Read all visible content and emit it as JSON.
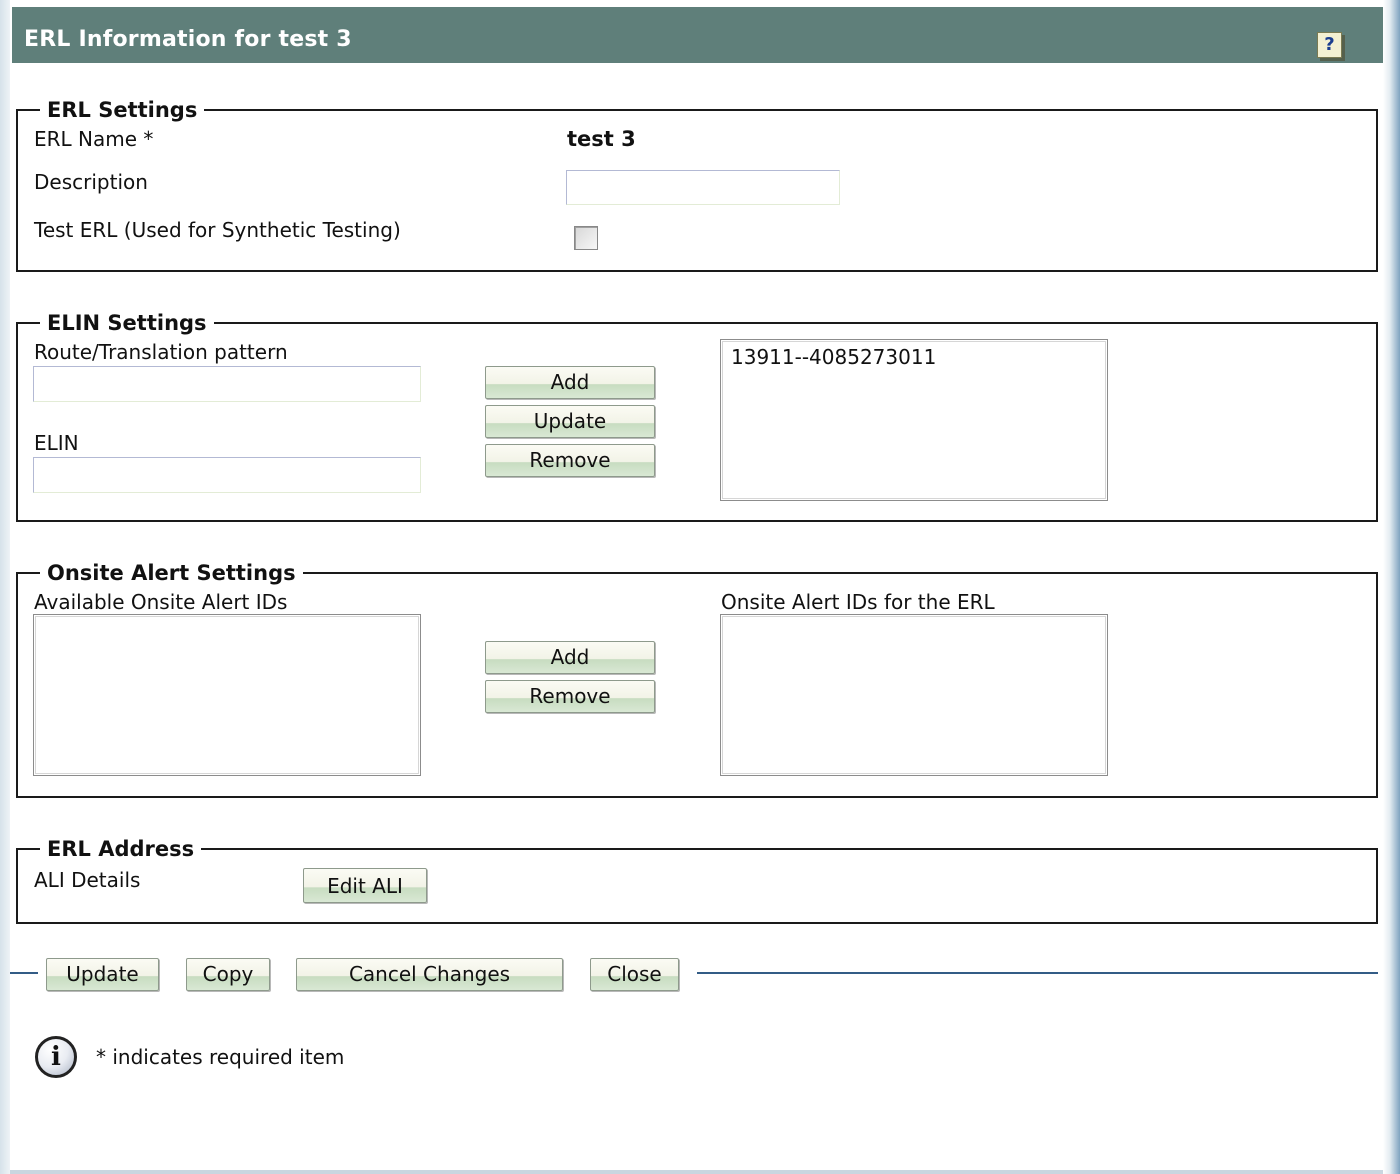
{
  "header": {
    "title": "ERL Information for test 3",
    "help_icon": "help-question-icon",
    "help_glyph": "?"
  },
  "erl_settings": {
    "legend": "ERL Settings",
    "name_label": "ERL Name *",
    "name_value": "test 3",
    "description_label": "Description",
    "description_value": "",
    "test_erl_label": "Test ERL (Used for Synthetic Testing)",
    "test_erl_checked": false
  },
  "elin_settings": {
    "legend": "ELIN Settings",
    "pattern_label": "Route/Translation pattern",
    "pattern_value": "",
    "elin_label": "ELIN",
    "elin_value": "",
    "add_label": "Add",
    "update_label": "Update",
    "remove_label": "Remove",
    "list_items": [
      "13911--4085273011"
    ]
  },
  "onsite_alert_settings": {
    "legend": "Onsite Alert Settings",
    "available_label": "Available Onsite Alert IDs",
    "assigned_label": "Onsite Alert IDs for the ERL",
    "available_items": [],
    "assigned_items": [],
    "add_label": "Add",
    "remove_label": "Remove"
  },
  "erl_address": {
    "legend": "ERL Address",
    "ali_label": "ALI Details",
    "edit_ali_label": "Edit ALI"
  },
  "actions": {
    "update_label": "Update",
    "copy_label": "Copy",
    "cancel_label": "Cancel Changes",
    "close_label": "Close"
  },
  "footer": {
    "info_icon": "info-icon",
    "info_glyph": "i",
    "required_note": "* indicates required item"
  },
  "colors": {
    "title_bar": "#5f7f7a",
    "divider_line": "#335c86",
    "button_gradient_bottom": "#c7dcc0"
  }
}
